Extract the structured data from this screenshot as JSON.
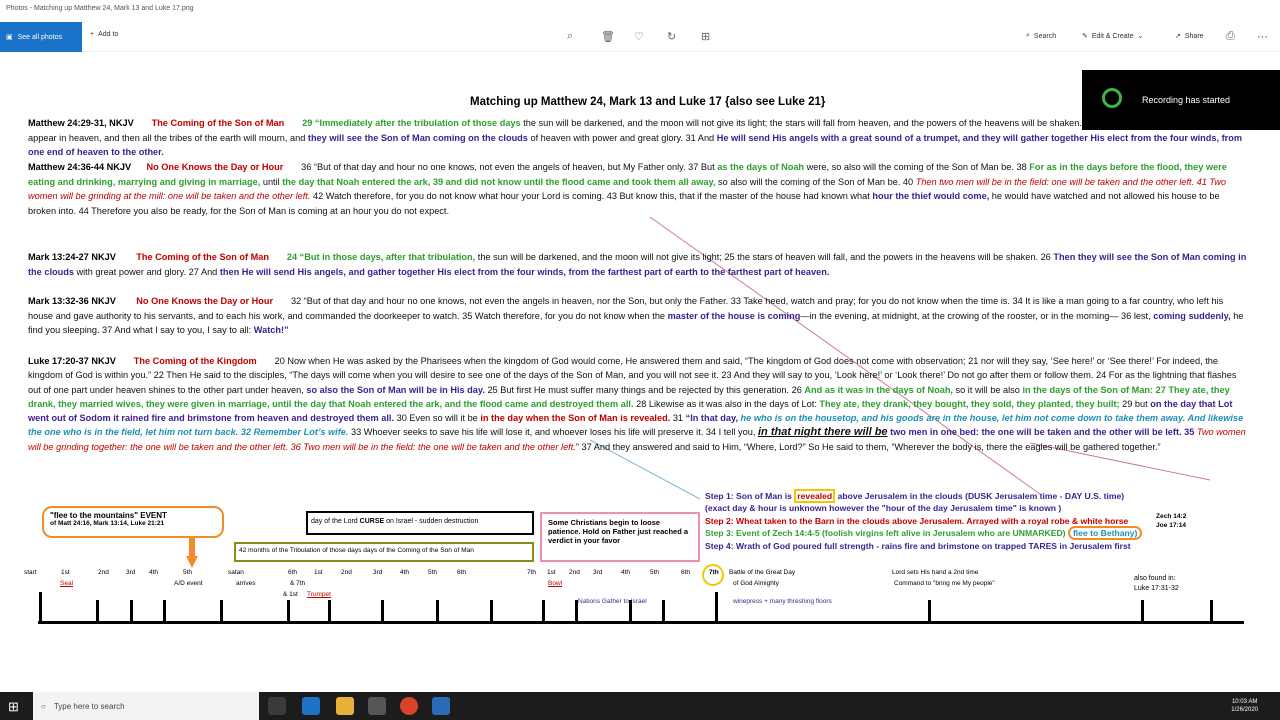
{
  "window": {
    "title": "Photos - Matching up Matthew 24, Mark 13 and Luke 17.png"
  },
  "toolbar": {
    "see_all_photos": "See all photos",
    "add_to": "Add to",
    "search": "Search",
    "edit_create": "Edit & Create",
    "share": "Share"
  },
  "notification": {
    "text": "Recording has started"
  },
  "doc": {
    "title": "Matching up Matthew 24, Mark 13 and Luke 17        {also see Luke 21}",
    "matt1": {
      "ref": "Matthew 24:29-31,    NKJV",
      "hdr": "The Coming of the Son of Man",
      "t1": "29 “Immediately after the tribulation of those days",
      "t2": " the sun will be darkened, and the moon will not give its light; the stars will fall from heaven, and the powers of the heavens will be shaken. 30 Then the sign of the Son of Man will appear in heaven, and then all the tribes of the earth will mourn, and ",
      "t3": "they will see the Son of Man coming on the clouds",
      "t4": " of heaven with power and great glory. 31 And ",
      "t5": "He will send His angels with a great sound of a trumpet, and they will gather together His elect from the four winds, from one end of heaven to the other."
    },
    "matt2": {
      "ref": "Matthew 24:36-44 NKJV",
      "hdr": "No One Knows the Day or Hour",
      "t1": "36 “But of that day and hour no one knows, not even the angels of heaven, but My Father only. 37 But ",
      "t2": "as the days of Noah",
      "t3": " were, so also will the coming of the Son of Man be. 38 ",
      "t4": "For as in the days before the flood, they were eating and drinking, marrying and giving in marriage,",
      "t5": " until ",
      "t6": "the day that Noah entered the ark, 39 and did not know until the flood came and took them all away,",
      "t7": " so also will the coming of the Son of Man be. 40 ",
      "t8": "Then two men will be in the field: one will be taken and the other left. 41 Two women will be grinding at the mill: one will be taken and the other left.",
      "t9": " 42 Watch therefore, for you do not know what hour your Lord is coming. 43 But know this, that if the master of the house had known what ",
      "t10": "hour the thief would come,",
      "t11": " he would have watched and not allowed his house to be broken into. 44 Therefore you also be ready, for the Son of Man is coming at an hour you do not expect."
    },
    "mark1": {
      "ref": "Mark 13:24-27 NKJV",
      "hdr": "The Coming of the Son of Man",
      "t1": "24 “But in those days, after that tribulation,",
      "t2": " the sun will be darkened, and the moon will not give its light; 25 the stars of heaven will fall, and the powers in the heavens will be shaken. 26 ",
      "t3": "Then they will see the Son of Man coming in the clouds",
      "t4": " with great power and glory. 27 And ",
      "t5": "then He will send His angels, and gather together His elect from the four winds, from the farthest part of earth to the farthest part of heaven."
    },
    "mark2": {
      "ref": "Mark 13:32-36 NKJV",
      "hdr": "No One Knows the Day or Hour",
      "t1": "32 “But of that day and hour no one knows, not even the angels in heaven, nor the Son, but only the Father. 33 Take heed, watch and pray; for you do not know when the time is. 34 It is like a man going to a far country, who left his house and gave authority to his servants, and to each his work, and commanded the doorkeeper to watch. 35 Watch therefore, for you do not know when the ",
      "t2": "master of the house is coming",
      "t3": "—in the evening, at midnight, at the crowing of the rooster, or in the morning— 36 lest, ",
      "t4": "coming suddenly,",
      "t5": " he find you sleeping. 37 And what I say to you, I say to all: ",
      "t6": "Watch!”"
    },
    "luke": {
      "ref": "Luke 17:20-37 NKJV",
      "hdr": "The Coming of the Kingdom",
      "t1": "20 Now when He was asked by the Pharisees when the kingdom of God would come, He answered them and said, “The kingdom of God does not come with observation; 21 nor will they say, ‘See here!’ or ‘See there!’ For indeed, the kingdom of God is within you.” 22 Then He said to the disciples, “The days will come when you will desire to see one of the days of the Son of Man, and you will not see it. 23 And they will say to you, ‘Look here!’ or ‘Look there!’ Do not go after them or follow them. 24 For as the lightning that flashes out of one part under heaven shines to the other part under heaven, ",
      "t2": "so also the Son of Man will be in His day.",
      "t3": " 25 But first He must suffer many things and be rejected by this generation. 26 ",
      "t4": "And as it was in the days of Noah,",
      "t5": " so it will be also ",
      "t6": "in the days of the Son of Man: 27 They ate, they drank, they married wives, they were given in marriage, until the day that Noah entered the ark, and the flood came and destroyed them all.",
      "t7": " 28 Likewise as it was also in the days of Lot: ",
      "t8": "They ate, they drank, they bought, they sold, they planted, they built;",
      "t9": " 29 but ",
      "t10": "on the day that Lot went out of Sodom it rained fire and brimstone from heaven and destroyed them all.",
      "t11": " 30 Even so will it be ",
      "t12": "in the day when the Son of Man is revealed.",
      "t13": " 31 ",
      "t14": "“In that day,",
      "t15": " he who is on the housetop, and his goods are in the house, let him not come down to take them away. And likewise the one who is in the field, let him not turn back. 32 Remember Lot’s wife.",
      "t16": " 33 Whoever seeks to save his life will lose it, and whoever loses his life will preserve it. 34 I tell you, ",
      "t17": "in that night there will be",
      "t18": " two men in one bed: the one will be taken and the other will be left. 35 ",
      "t19": "Two women will be grinding together: the one will be taken and the other left. 36 Two men will be in the field: the one will be taken and the other left.",
      "t20": "” 37 And they answered and said to Him, “Where, Lord?” So He said to them, “Wherever the body is, there the eagles will be gathered together.”"
    }
  },
  "boxes": {
    "flee1": "\"flee to the mountains\" EVENT",
    "flee2": "of Matt 24:16, Mark 13:14, Luke 21:21",
    "curse_a": "day of the Lord ",
    "curse_b": "CURSE",
    "curse_c": " on Israel - sudden destruction",
    "months": "42 months of the Tribulation of those days   days of the Coming of the Son of Man",
    "pink": "Some Christians begin to loose patience. Hold on Father just reached a verdict in your favor"
  },
  "steps": {
    "s1a": "Step 1: Son of Man is ",
    "s1b": "revealed",
    "s1c": " above Jerusalem in the clouds (DUSK Jerusalem time - DAY U.S. time)",
    "s1d": "(exact day & hour is unknown however the \"hour of the day Jerusalem time\" is known )",
    "s2": "Step 2: Wheat taken to the Barn in the clouds above Jerusalem.  Arrayed with a royal robe & white horse",
    "s3a": "Step 3: Event of Zech 14:4-5 (foolish virgins left alive in Jerusalem who are UNMARKED) ",
    "s3b": "flee to Bethany)",
    "s4": "Step 4: Wrath of God poured full strength - rains fire and brimstone on trapped TARES in Jerusalem first"
  },
  "side": {
    "n1": "Zech 14:2",
    "n2": "Joe 17:14",
    "also1": "also found in:",
    "also2": "Luke 17:31-32"
  },
  "timeline": {
    "labels": [
      "start",
      "1st",
      "2nd",
      "3rd",
      "4th",
      "5th",
      "satan",
      "6th",
      "1st",
      "2nd",
      "3rd",
      "4th",
      "5th",
      "6th",
      "7th",
      "1st",
      "2nd",
      "3rd",
      "4th",
      "5th",
      "6th",
      "7th"
    ],
    "seal": "Seal",
    "ab_event": "A/D event",
    "arrives": "arrives",
    "and7": "& 7th",
    "and1st": "& 1st",
    "trumpet": "Trumpet",
    "bowl": "Bowl",
    "battle1": "Battle of the Great Day",
    "battle2": "of God Almighty",
    "nations": "Nations Gather to Israel",
    "winepress": "winepress + many threshing floors",
    "lord1": "Lord sets His hand a 2nd time",
    "lord2": "Command to \"bring me My people\""
  },
  "taskbar": {
    "search_placeholder": "Type here to search",
    "time": "10:03 AM",
    "date": "1/26/2020"
  }
}
